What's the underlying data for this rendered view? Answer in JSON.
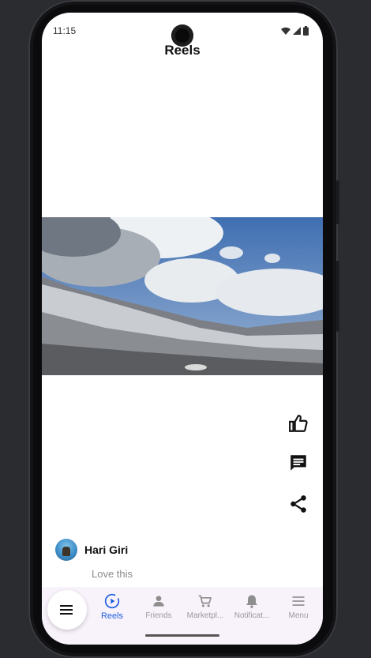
{
  "status_bar": {
    "time": "11:15"
  },
  "header": {
    "title": "Reels"
  },
  "reel": {
    "author": "Hari Giri",
    "caption": "Love this",
    "actions": [
      "like-icon",
      "comment-icon",
      "share-icon"
    ]
  },
  "bottom_nav": {
    "menu_fab_icon": "hamburger-icon",
    "items": [
      {
        "label": "Reels",
        "icon": "play-circle-icon",
        "active": true
      },
      {
        "label": "Friends",
        "icon": "person-icon",
        "active": false
      },
      {
        "label": "Marketpl...",
        "icon": "cart-icon",
        "active": false
      },
      {
        "label": "Notificat...",
        "icon": "bell-icon",
        "active": false
      },
      {
        "label": "Menu",
        "icon": "menu-icon",
        "active": false
      }
    ]
  },
  "colors": {
    "accent": "#1f5fe0",
    "nav_bg": "#f8f2fb",
    "inactive": "#9a9a9a"
  }
}
